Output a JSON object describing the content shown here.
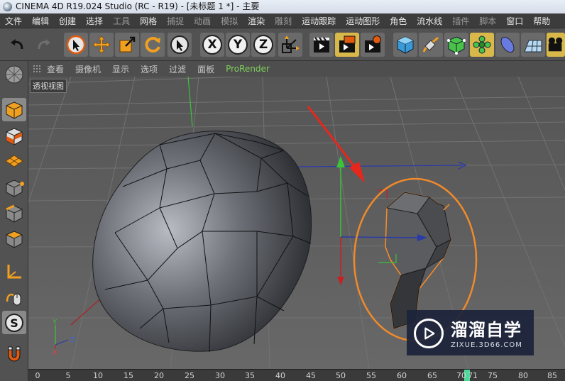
{
  "window": {
    "title": "CINEMA 4D R19.024 Studio (RC - R19) - [未标题 1 *] - 主要"
  },
  "menubar": {
    "items": [
      "文件",
      "编辑",
      "创建",
      "选择",
      "工具",
      "网格",
      "捕捉",
      "动画",
      "模拟",
      "渲染",
      "雕刻",
      "运动跟踪",
      "运动图形",
      "角色",
      "流水线",
      "插件",
      "脚本",
      "窗口",
      "帮助"
    ]
  },
  "toolbar": {
    "tools": [
      {
        "name": "undo-icon",
        "label": ""
      },
      {
        "name": "redo-icon",
        "label": ""
      },
      {
        "name": "live-selection-icon",
        "label": ""
      },
      {
        "name": "move-icon",
        "label": ""
      },
      {
        "name": "scale-icon",
        "label": ""
      },
      {
        "name": "rotate-icon",
        "label": ""
      },
      {
        "name": "last-tool-icon",
        "label": ""
      },
      {
        "name": "x-axis-lock-icon",
        "label": "X"
      },
      {
        "name": "y-axis-lock-icon",
        "label": "Y"
      },
      {
        "name": "z-axis-lock-icon",
        "label": "Z"
      },
      {
        "name": "coordinate-system-icon",
        "label": ""
      },
      {
        "name": "render-view-icon",
        "label": ""
      },
      {
        "name": "render-picture-viewer-icon",
        "label": ""
      },
      {
        "name": "render-settings-icon",
        "label": ""
      },
      {
        "name": "cube-icon",
        "label": ""
      },
      {
        "name": "pen-icon",
        "label": ""
      },
      {
        "name": "subdivision-icon",
        "label": ""
      },
      {
        "name": "cloner-icon",
        "label": ""
      },
      {
        "name": "deformer-icon",
        "label": ""
      },
      {
        "name": "floor-icon",
        "label": ""
      },
      {
        "name": "camera-icon",
        "label": ""
      }
    ]
  },
  "lefttools": [
    "model-mode-icon",
    "texture-mode-icon",
    "workplane-mode-icon",
    "points-mode-icon",
    "edges-mode-icon",
    "polygons-mode-icon",
    "axis-mode-icon",
    "tweak-mode-icon",
    "snap-icon",
    "magnet-icon"
  ],
  "viewport_menu": {
    "items": [
      "查看",
      "摄像机",
      "显示",
      "选项",
      "过滤",
      "面板",
      "ProRender"
    ]
  },
  "viewport": {
    "label": "透视视图",
    "axis_labels": {
      "x": "X",
      "y": "Y",
      "z": "Z"
    }
  },
  "timeline": {
    "ticks": [
      "0",
      "5",
      "10",
      "15",
      "20",
      "25",
      "30",
      "35",
      "40",
      "45",
      "50",
      "55",
      "60",
      "65",
      "70",
      "71",
      "75",
      "80",
      "85"
    ],
    "current_frame": "71"
  },
  "watermark": {
    "title": "溜溜自学",
    "url": "ZIXUE.3D66.COM"
  },
  "colors": {
    "accent_selected": "#d9b84a",
    "annotation_red": "#e8261c",
    "annotation_orange": "#f08a2a",
    "axis_blue": "#2a3aa8",
    "axis_green": "#3ac43a",
    "playhead_green": "#4fd89a"
  }
}
